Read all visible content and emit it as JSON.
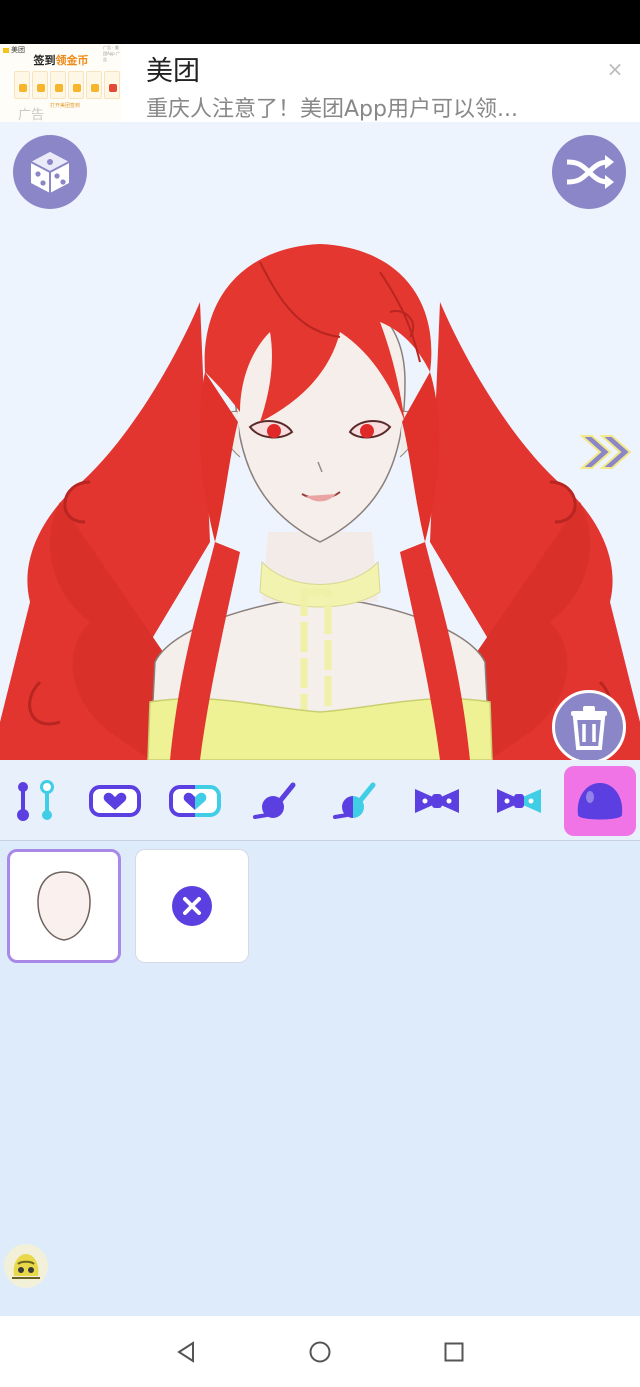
{
  "ad": {
    "thumb_brand": "美团",
    "thumb_tiny": "广告 · 美团App 广告",
    "thumb_headline_prefix": "签到",
    "thumb_headline_highlight": "领金币",
    "thumb_sub": "打开美团签到",
    "ad_label": "广告",
    "title": "美团",
    "description": "重庆人注意了！美团App用户可以领...",
    "close_glyph": "×"
  },
  "colors": {
    "accent_purple": "#8a86c8",
    "tool_purple": "#5b3fe0",
    "selected_tool_bg": "#f074e6",
    "hair_red": "#e0302c",
    "panel_bg": "#deebfa"
  },
  "toolbar": {
    "tools": [
      {
        "name": "sliders-icon",
        "selected": false
      },
      {
        "name": "heart-card-icon",
        "selected": false
      },
      {
        "name": "heart-card-half-icon",
        "selected": false
      },
      {
        "name": "paint-brush-icon",
        "selected": false
      },
      {
        "name": "paint-brush-half-icon",
        "selected": false
      },
      {
        "name": "bow-icon",
        "selected": false
      },
      {
        "name": "bow-half-icon",
        "selected": false
      },
      {
        "name": "blob-icon",
        "selected": true
      }
    ]
  },
  "items": [
    {
      "name": "face-shape",
      "selected": true
    },
    {
      "name": "none",
      "selected": false
    }
  ],
  "icons": {
    "dice": "dice-icon",
    "shuffle": "shuffle-icon",
    "trash": "trash-icon",
    "next": "double-chevron-right-icon",
    "mascot": "mascot-icon"
  }
}
